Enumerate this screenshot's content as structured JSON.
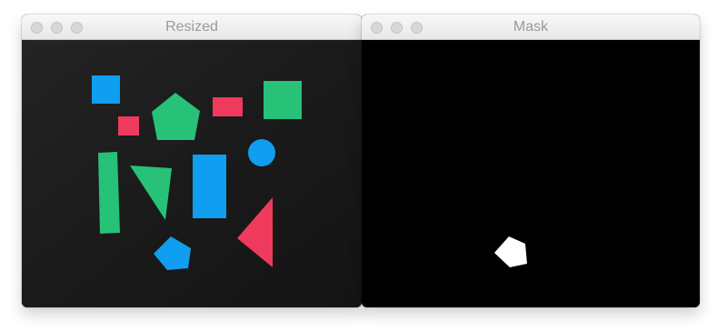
{
  "windows": [
    {
      "title": "Resized"
    },
    {
      "title": "Mask"
    }
  ],
  "colors": {
    "board": "#1c1c1c",
    "blue": "#0f9ef0",
    "green": "#27c178",
    "red": "#ee3b5d",
    "mask_background": "#000000",
    "mask_shape": "#ffffff"
  }
}
